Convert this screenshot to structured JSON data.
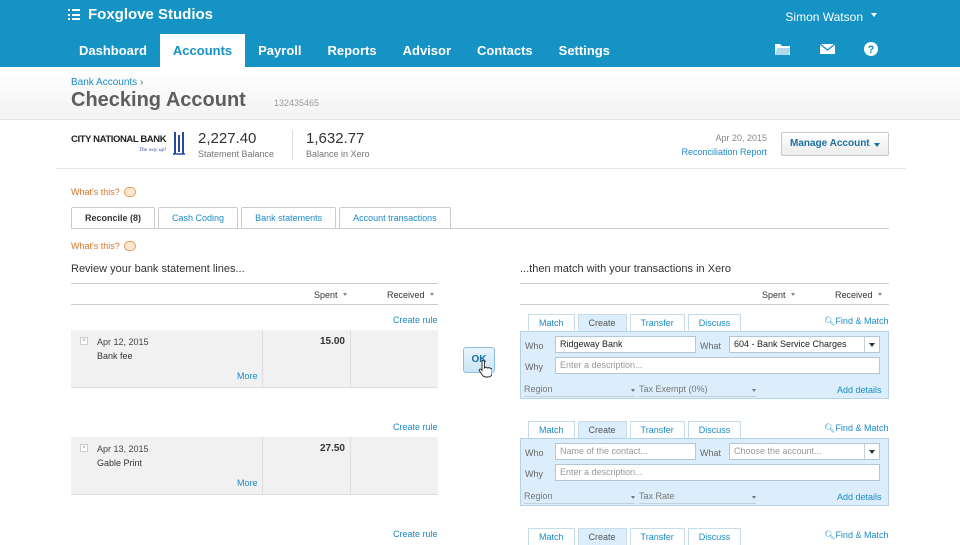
{
  "org": {
    "name": "Foxglove Studios"
  },
  "user": {
    "name": "Simon Watson"
  },
  "nav": [
    "Dashboard",
    "Accounts",
    "Payroll",
    "Reports",
    "Advisor",
    "Contacts",
    "Settings"
  ],
  "nav_active": "Accounts",
  "top_icons": [
    "folder-icon",
    "mail-icon",
    "help-icon"
  ],
  "breadcrumb": {
    "link": "Bank Accounts",
    "separator": "›"
  },
  "page": {
    "title": "Checking Account",
    "account_number": "132435465"
  },
  "bank": {
    "logo_text": "CITY NATIONAL BANK",
    "logo_tagline": "The way up!",
    "statement_balance": "2,227.40",
    "statement_balance_label": "Statement Balance",
    "xero_balance": "1,632.77",
    "xero_balance_label": "Balance in Xero",
    "reconcile_date": "Apr 20, 2015",
    "reconcile_link": "Reconciliation Report",
    "manage_button": "Manage Account"
  },
  "whats_this": "What's this?",
  "tabs": [
    "Reconcile (8)",
    "Cash Coding",
    "Bank statements",
    "Account transactions"
  ],
  "left_heading": "Review your bank statement lines...",
  "right_heading": "...then match with your transactions in Xero",
  "columns": {
    "spent": "Spent",
    "received": "Received"
  },
  "create_rule": "Create rule",
  "more": "More",
  "ok_button": "OK",
  "statement_lines": [
    {
      "date": "Apr 12, 2015",
      "name": "Bank fee",
      "spent": "15.00",
      "received": ""
    },
    {
      "date": "Apr 13, 2015",
      "name": "Gable Print",
      "spent": "27.50",
      "received": ""
    }
  ],
  "match_tabs": [
    "Match",
    "Create",
    "Transfer",
    "Discuss"
  ],
  "match_active": "Create",
  "find_match": "Find & Match",
  "labels": {
    "who": "Who",
    "what": "What",
    "why": "Why"
  },
  "add_details": "Add details",
  "matches": [
    {
      "who": "Ridgeway Bank",
      "who_placeholder": "Name of the contact...",
      "what": "604 - Bank Service Charges",
      "what_placeholder": "Choose the account...",
      "why_placeholder": "Enter a description...",
      "region": "Region",
      "tax": "Tax Exempt (0%)"
    },
    {
      "who": "",
      "who_placeholder": "Name of the contact...",
      "what": "",
      "what_placeholder": "Choose the account...",
      "why_placeholder": "Enter a description...",
      "region": "Region",
      "tax": "Tax Rate"
    }
  ],
  "colors": {
    "brand": "#1593c5",
    "link": "#1a8bc8",
    "accent": "#d6762a"
  }
}
